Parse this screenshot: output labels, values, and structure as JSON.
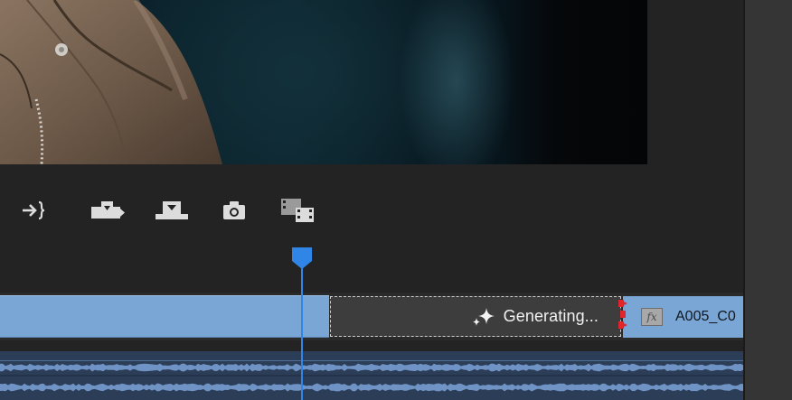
{
  "timeline": {
    "generating_clip": {
      "label": "Generating..."
    },
    "right_clip": {
      "fx_label": "fx",
      "name": "A005_C0"
    }
  },
  "colors": {
    "clip_blue": "#7aa6d6",
    "playhead_blue": "#2f86e6",
    "generating_bg": "#3d3d3d",
    "trim_handle_red": "#e0252d",
    "audio_track_bg": "#2c3d57"
  },
  "icons": {
    "go_to_out_point": "go-to-out-point-icon",
    "insert": "insert-icon",
    "overwrite": "overwrite-icon",
    "export_frame": "camera-icon",
    "compare_view": "comparison-view-icon",
    "generating": "sparkle-icon"
  }
}
